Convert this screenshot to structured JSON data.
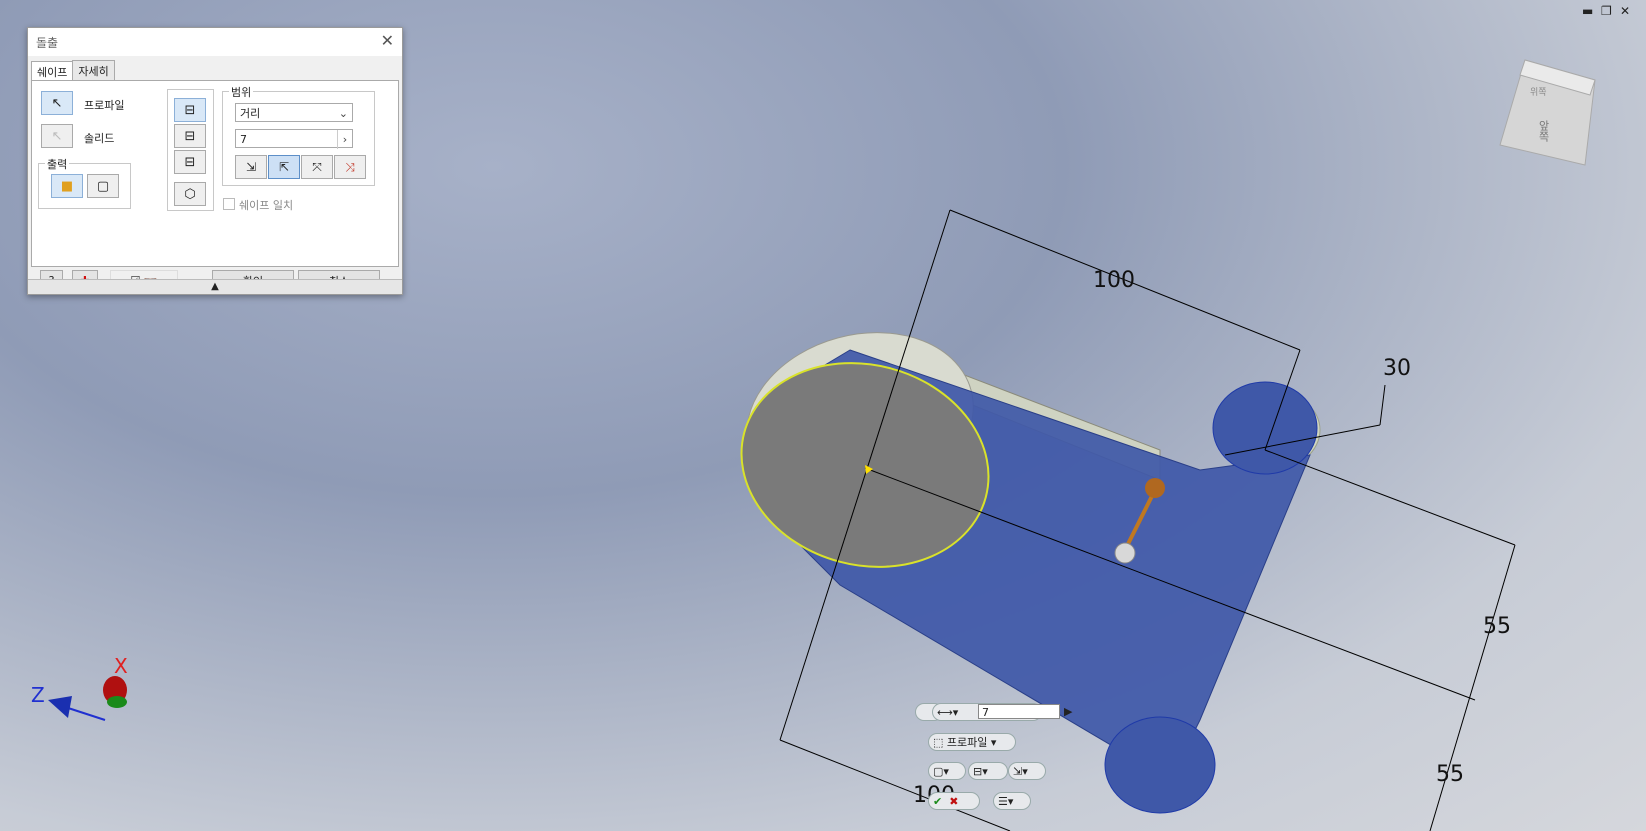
{
  "window": {
    "minimize": "▬",
    "restore": "❐",
    "close": "✕"
  },
  "dialog": {
    "title": "돌출",
    "close_icon": "✕",
    "tabs": [
      {
        "label": "쉐이프"
      },
      {
        "label": "자세히"
      }
    ],
    "profile_label": "프로파일",
    "solid_label": "솔리드",
    "output_group": "출력",
    "range_group": "범위",
    "range_value": "거리",
    "distance_value": "7",
    "match_shape_label": "쉐이프 일치",
    "ok_label": "확인",
    "cancel_label": "취소",
    "expand_icon": "▲"
  },
  "viewcube": {
    "faces": [
      "앞쪽",
      "위쪽"
    ]
  },
  "axis": {
    "x": "X",
    "z": "Z",
    "x_color": "#e02020",
    "z_color": "#2030d0"
  },
  "dimensions": [
    "100",
    "30",
    "55",
    "55",
    "100"
  ],
  "minitoolbar": {
    "distance_value": "7",
    "profile_label": "프로파일"
  },
  "colors": {
    "part_blue": "#3f58a8",
    "highlight": "#d9e22a"
  }
}
